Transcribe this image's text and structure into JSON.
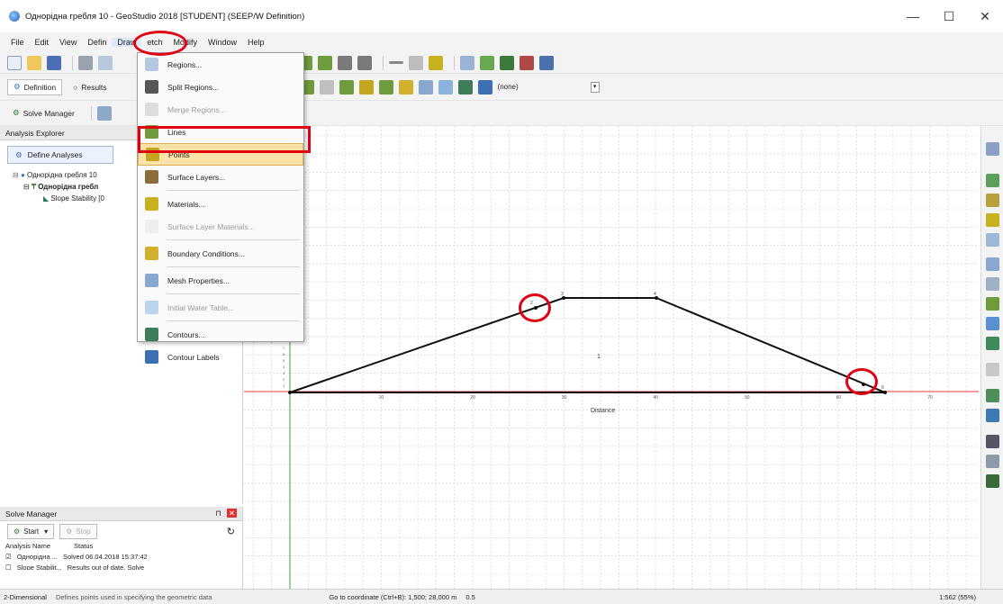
{
  "window": {
    "title": "Однорідна гребля 10 - GeoStudio 2018 [STUDENT] (SEEP/W Definition)",
    "minimize": "—",
    "maximize": "☐",
    "close": "✕"
  },
  "menu": [
    "File",
    "Edit",
    "View",
    "Define",
    "Draw",
    "Sketch",
    "Modify",
    "Window",
    "Help"
  ],
  "menu_display": [
    "File",
    "Edit",
    "View",
    "Defin",
    "Draw",
    "etch",
    "Modify",
    "Window",
    "Help"
  ],
  "toolbar2": {
    "definition": "Definition",
    "results": "Results",
    "none_select": "(none)"
  },
  "toolbar3": {
    "solve_manager": "Solve Manager"
  },
  "dropdown": {
    "items": [
      {
        "label": "Regions...",
        "enabled": true,
        "icon": "regions-icon"
      },
      {
        "label": "Split Regions...",
        "enabled": true,
        "icon": "split-regions-icon"
      },
      {
        "label": "Merge Regions...",
        "enabled": false,
        "icon": "merge-regions-icon"
      },
      {
        "label": "Lines",
        "enabled": true,
        "icon": "lines-icon"
      },
      {
        "label": "Points",
        "enabled": true,
        "icon": "points-icon",
        "highlight": true
      },
      {
        "label": "Surface Layers...",
        "enabled": true,
        "icon": "surface-layers-icon"
      },
      {
        "label": "Materials...",
        "enabled": true,
        "icon": "materials-icon"
      },
      {
        "label": "Surface Layer Materials...",
        "enabled": false,
        "icon": "surface-layer-materials-icon"
      },
      {
        "label": "Boundary Conditions...",
        "enabled": true,
        "icon": "boundary-conditions-icon"
      },
      {
        "label": "Mesh Properties...",
        "enabled": true,
        "icon": "mesh-properties-icon"
      },
      {
        "label": "Initial Water Table...",
        "enabled": false,
        "icon": "initial-water-table-icon"
      },
      {
        "label": "Contours...",
        "enabled": true,
        "icon": "contours-icon"
      },
      {
        "label": "Contour Labels",
        "enabled": true,
        "icon": "contour-labels-icon"
      }
    ]
  },
  "analysis_explorer": {
    "title": "Analysis Explorer",
    "define_button": "Define Analyses",
    "tree": [
      {
        "label": "Однорідна гребля 10",
        "level": 0
      },
      {
        "label": "Однорідна гребл",
        "level": 1
      },
      {
        "label": "Slope Stability [0",
        "level": 2
      }
    ]
  },
  "solve_manager_panel": {
    "title": "Solve Manager",
    "start": "Start",
    "stop": "Stop",
    "col_name": "Analysis Name",
    "col_status": "Status",
    "rows": [
      {
        "name": "Однорідна ...",
        "status": "Solved 06.04.2018 15:37:42"
      },
      {
        "name": "Slope Stabilit...",
        "status": "Results out of date. Solve"
      }
    ]
  },
  "canvas": {
    "x_axis_label": "Distance",
    "x_ticks": [
      "10",
      "20",
      "30",
      "40",
      "50",
      "60",
      "70"
    ],
    "y_ticks": [
      "1",
      "2",
      "3",
      "4",
      "5",
      "6",
      "7"
    ],
    "region_label": "1",
    "point_labels": [
      "1",
      "2",
      "3",
      "4",
      "5",
      "6"
    ]
  },
  "status": {
    "mode": "2-Dimensional",
    "hint": "Defines points used in specifying the geometric data",
    "goto": "Go to coordinate (Ctrl+B): 1,500; 28,000 m",
    "zoom_value": "0.5",
    "scale": "1:562 (55%)"
  },
  "colors": {
    "highlight_red": "#e00012",
    "menu_highlight": "#fbe3a8",
    "grid": "#cfcfcf",
    "axis_red": "#e53935",
    "axis_green": "#43a047"
  }
}
